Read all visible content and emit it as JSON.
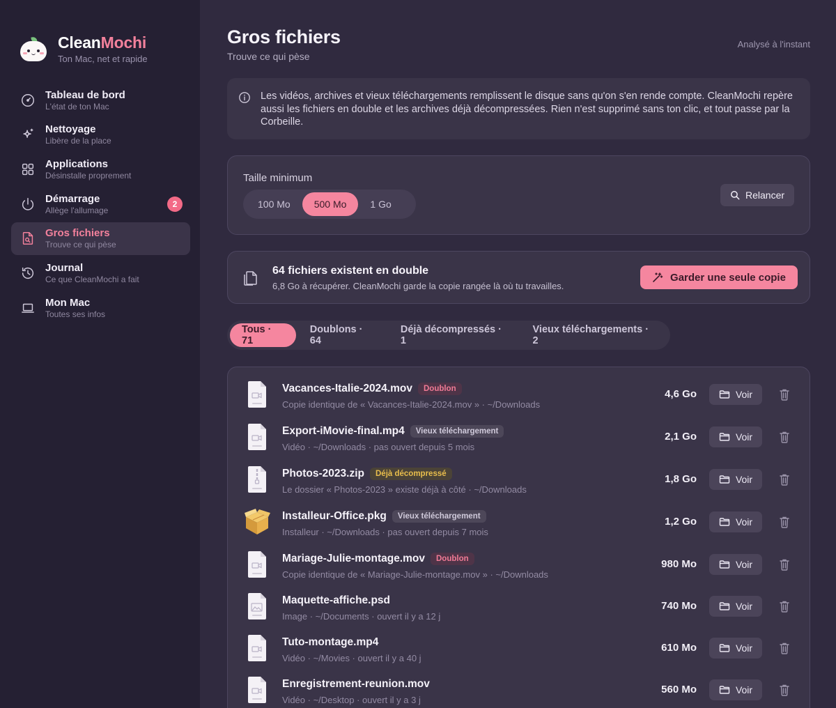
{
  "brand": {
    "name_a": "Clean",
    "name_b": "Mochi",
    "tagline": "Ton Mac, net et rapide"
  },
  "sidebar": {
    "items": [
      {
        "title": "Tableau de bord",
        "sub": "L'état de ton Mac",
        "icon": "gauge-icon"
      },
      {
        "title": "Nettoyage",
        "sub": "Libère de la place",
        "icon": "sparkles-icon"
      },
      {
        "title": "Applications",
        "sub": "Désinstalle proprement",
        "icon": "grid-icon"
      },
      {
        "title": "Démarrage",
        "sub": "Allège l'allumage",
        "icon": "power-icon",
        "badge": "2"
      },
      {
        "title": "Gros fichiers",
        "sub": "Trouve ce qui pèse",
        "icon": "file-search-icon",
        "active": true
      },
      {
        "title": "Journal",
        "sub": "Ce que CleanMochi a fait",
        "icon": "history-icon"
      },
      {
        "title": "Mon Mac",
        "sub": "Toutes ses infos",
        "icon": "laptop-icon"
      }
    ]
  },
  "header": {
    "title": "Gros fichiers",
    "subtitle": "Trouve ce qui pèse",
    "scanned": "Analysé à l'instant"
  },
  "info": {
    "text": "Les vidéos, archives et vieux téléchargements remplissent le disque sans qu'on s'en rende compte. CleanMochi repère aussi les fichiers en double et les archives déjà décompressées. Rien n'est supprimé sans ton clic, et tout passe par la Corbeille."
  },
  "size_filter": {
    "label": "Taille minimum",
    "options": [
      "100 Mo",
      "500 Mo",
      "1 Go"
    ],
    "selected": "500 Mo",
    "rerun_label": "Relancer"
  },
  "duplicates": {
    "title": "64 fichiers existent en double",
    "subtitle": "6,8 Go à récupérer. CleanMochi garde la copie rangée là où tu travailles.",
    "action_label": "Garder une seule copie"
  },
  "tabs": [
    {
      "label": "Tous · 71",
      "active": true
    },
    {
      "label": "Doublons · 64"
    },
    {
      "label": "Déjà décompressés · 1"
    },
    {
      "label": "Vieux téléchargements · 2"
    }
  ],
  "files": [
    {
      "name": "Vacances-Italie-2024.mov",
      "badge": "Doublon",
      "badge_type": "dup",
      "sub": "Copie identique de « Vacances-Italie-2024.mov » · ~/Downloads",
      "size": "4,6 Go",
      "icon": "video-file-icon"
    },
    {
      "name": "Export-iMovie-final.mp4",
      "badge": "Vieux téléchargement",
      "badge_type": "old",
      "sub": "Vidéo · ~/Downloads · pas ouvert depuis 5 mois",
      "size": "2,1 Go",
      "icon": "video-file-icon"
    },
    {
      "name": "Photos-2023.zip",
      "badge": "Déjà décompressé",
      "badge_type": "dec",
      "sub": "Le dossier « Photos-2023 » existe déjà à côté · ~/Downloads",
      "size": "1,8 Go",
      "icon": "zip-file-icon"
    },
    {
      "name": "Installeur-Office.pkg",
      "badge": "Vieux téléchargement",
      "badge_type": "old",
      "sub": "Installeur · ~/Downloads · pas ouvert depuis 7 mois",
      "size": "1,2 Go",
      "icon": "package-icon"
    },
    {
      "name": "Mariage-Julie-montage.mov",
      "badge": "Doublon",
      "badge_type": "dup",
      "sub": "Copie identique de « Mariage-Julie-montage.mov » · ~/Downloads",
      "size": "980 Mo",
      "icon": "video-file-icon"
    },
    {
      "name": "Maquette-affiche.psd",
      "badge": "",
      "badge_type": "",
      "sub": "Image · ~/Documents · ouvert il y a 12 j",
      "size": "740 Mo",
      "icon": "image-file-icon"
    },
    {
      "name": "Tuto-montage.mp4",
      "badge": "",
      "badge_type": "",
      "sub": "Vidéo · ~/Movies · ouvert il y a 40 j",
      "size": "610 Mo",
      "icon": "video-file-icon"
    },
    {
      "name": "Enregistrement-reunion.mov",
      "badge": "",
      "badge_type": "",
      "sub": "Vidéo · ~/Desktop · ouvert il y a 3 j",
      "size": "560 Mo",
      "icon": "video-file-icon"
    }
  ],
  "row_actions": {
    "view_label": "Voir"
  },
  "colors": {
    "accent": "#f5869f",
    "sidebar_bg": "#252033",
    "main_bg": "#302a3f",
    "card_bg": "#3a3448"
  }
}
